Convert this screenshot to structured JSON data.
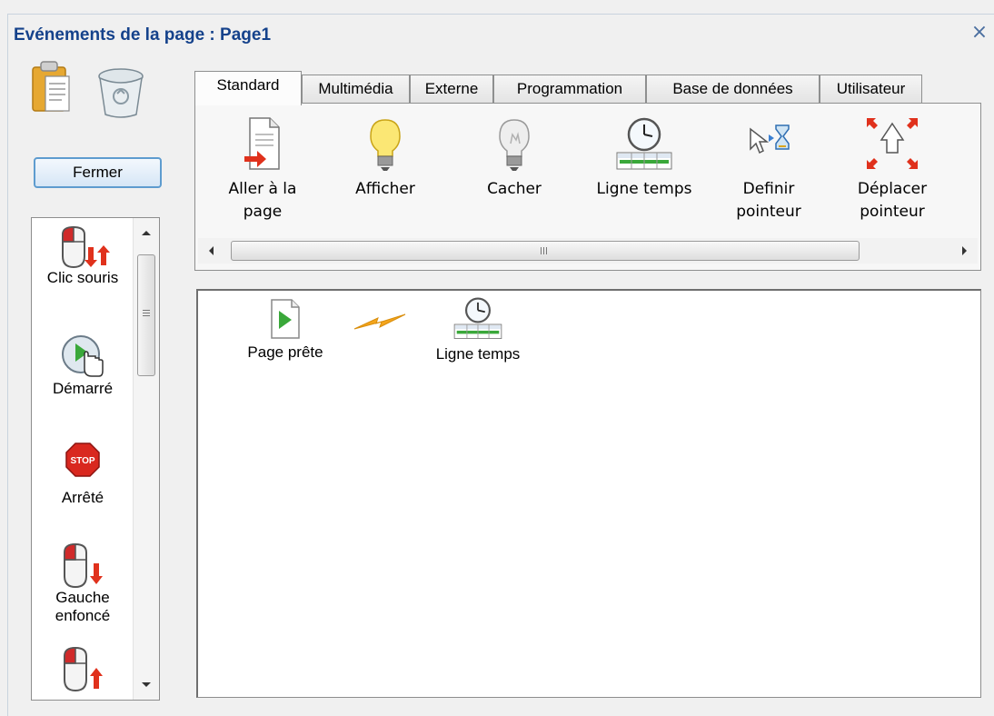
{
  "window": {
    "title": "Evénements de la page : Page1",
    "close_label": "×"
  },
  "left": {
    "close_button": "Fermer",
    "events": [
      {
        "label": "Clic souris",
        "icon": "mouse-click-icon"
      },
      {
        "label": "Démarré",
        "icon": "started-hand-icon"
      },
      {
        "label": "Arrêté",
        "icon": "stop-sign-icon"
      },
      {
        "label": "Gauche enfoncé",
        "icon": "mouse-left-down-icon"
      },
      {
        "label": "",
        "icon": "mouse-left-up-icon"
      }
    ]
  },
  "tabs": [
    {
      "label": "Standard",
      "active": true
    },
    {
      "label": "Multimédia"
    },
    {
      "label": "Externe"
    },
    {
      "label": "Programmation"
    },
    {
      "label": "Base de données"
    },
    {
      "label": "Utilisateur"
    }
  ],
  "actions": [
    {
      "label": "Aller à la page",
      "icon": "goto-page-icon"
    },
    {
      "label": "Afficher",
      "icon": "lightbulb-on-icon"
    },
    {
      "label": "Cacher",
      "icon": "lightbulb-off-icon"
    },
    {
      "label": "Ligne temps",
      "icon": "timeline-icon"
    },
    {
      "label": "Definir pointeur",
      "icon": "set-pointer-icon"
    },
    {
      "label": "Déplacer pointeur",
      "icon": "move-pointer-icon"
    }
  ],
  "canvas": {
    "nodes": [
      {
        "label": "Page prête",
        "icon": "page-ready-icon"
      },
      {
        "label": "Ligne temps",
        "icon": "timeline-icon"
      }
    ],
    "link_icon": "lightning-link-icon"
  },
  "colors": {
    "title": "#15428b",
    "button_border": "#5e9ccf",
    "accent_red": "#e0311c",
    "accent_green": "#3aa83a"
  }
}
